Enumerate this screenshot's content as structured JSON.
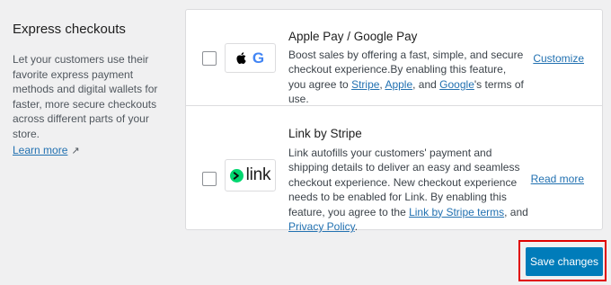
{
  "section": {
    "title": "Express checkouts",
    "description": "Let your customers use their favorite express payment methods and digital wallets for faster, more secure checkouts across different parts of your store.",
    "learn_more": "Learn more",
    "learn_more_icon": "external-link-icon"
  },
  "methods": [
    {
      "title": "Apple Pay / Google Pay",
      "logo_icons": [
        "apple-icon",
        "google-icon"
      ],
      "logo_google_letter": "G",
      "desc_text": "Boost sales by offering a fast, simple, and secure checkout experience.By enabling this feature, you agree to ",
      "link_stripe": "Stripe",
      "sep1": ", ",
      "link_apple": "Apple",
      "sep2": ", and ",
      "link_google": "Google",
      "desc_end": "'s terms of use.",
      "action": "Customize",
      "checked": false
    },
    {
      "title": "Link by Stripe",
      "logo_text": "link",
      "logo_icon": "link-arrow-icon",
      "desc_text": "Link autofills your customers' payment and shipping details to deliver an easy and seamless checkout experience. New checkout experience needs to be enabled for Link. By enabling this feature, you agree to the ",
      "link_terms": "Link by Stripe terms",
      "sep1": ", and ",
      "link_privacy": "Privacy Policy",
      "desc_end": ".",
      "action": "Read more",
      "checked": false
    }
  ],
  "footer": {
    "save_label": "Save changes"
  },
  "colors": {
    "accent": "#007cba",
    "link": "#2271b1",
    "highlight": "#e00000",
    "link_green": "#00d66f"
  }
}
